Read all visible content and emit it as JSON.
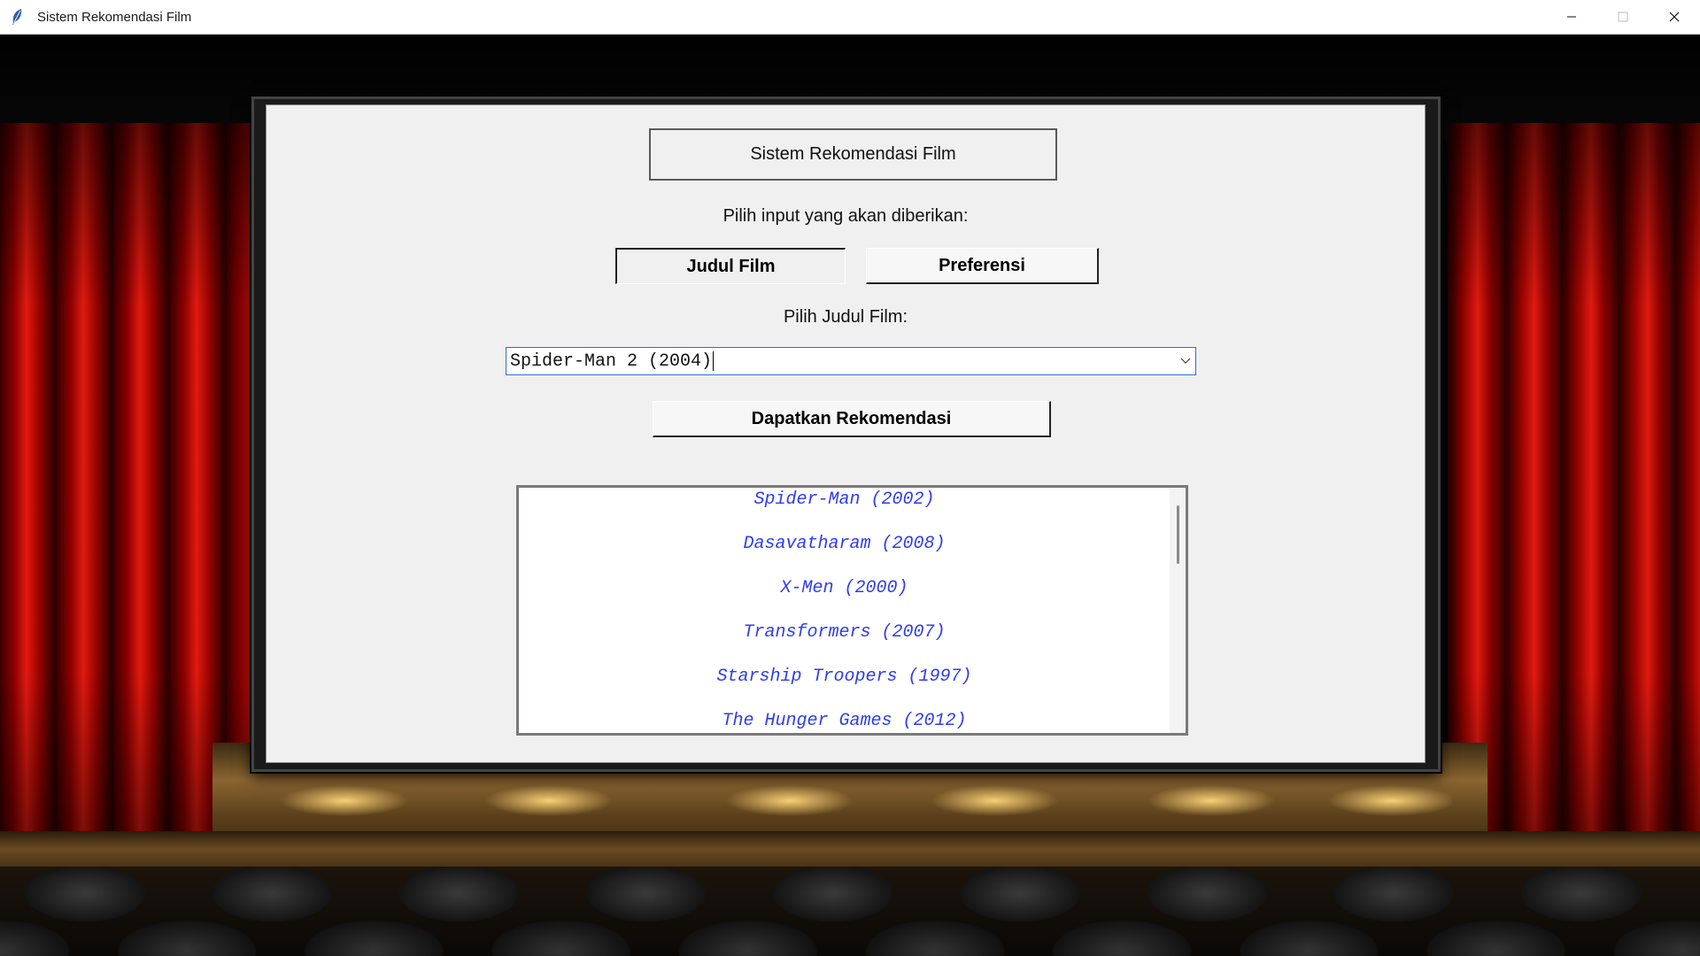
{
  "window": {
    "title": "Sistem Rekomendasi Film",
    "icon": "feather-icon",
    "controls": [
      "minimize-icon",
      "maximize-icon",
      "close-icon"
    ]
  },
  "app": {
    "title": "Sistem Rekomendasi Film",
    "input_prompt": "Pilih input yang akan diberikan:",
    "modes": [
      {
        "label": "Judul Film",
        "selected": true
      },
      {
        "label": "Preferensi",
        "selected": false
      }
    ],
    "movie_prompt": "Pilih Judul Film:",
    "movie_select": {
      "value": "Spider-Man 2 (2004)",
      "icon": "chevron-down-icon"
    },
    "action_label": "Dapatkan Rekomendasi",
    "results": [
      "Spider-Man (2002)",
      "Dasavatharam (2008)",
      "X-Men (2000)",
      "Transformers (2007)",
      "Starship Troopers (1997)",
      "The Hunger Games (2012)"
    ]
  },
  "colors": {
    "panel_bg": "#f0f0f0",
    "result_text": "#2f3cf0",
    "focus_border": "#2b6fd6",
    "curtain_red": "#e01a10"
  }
}
